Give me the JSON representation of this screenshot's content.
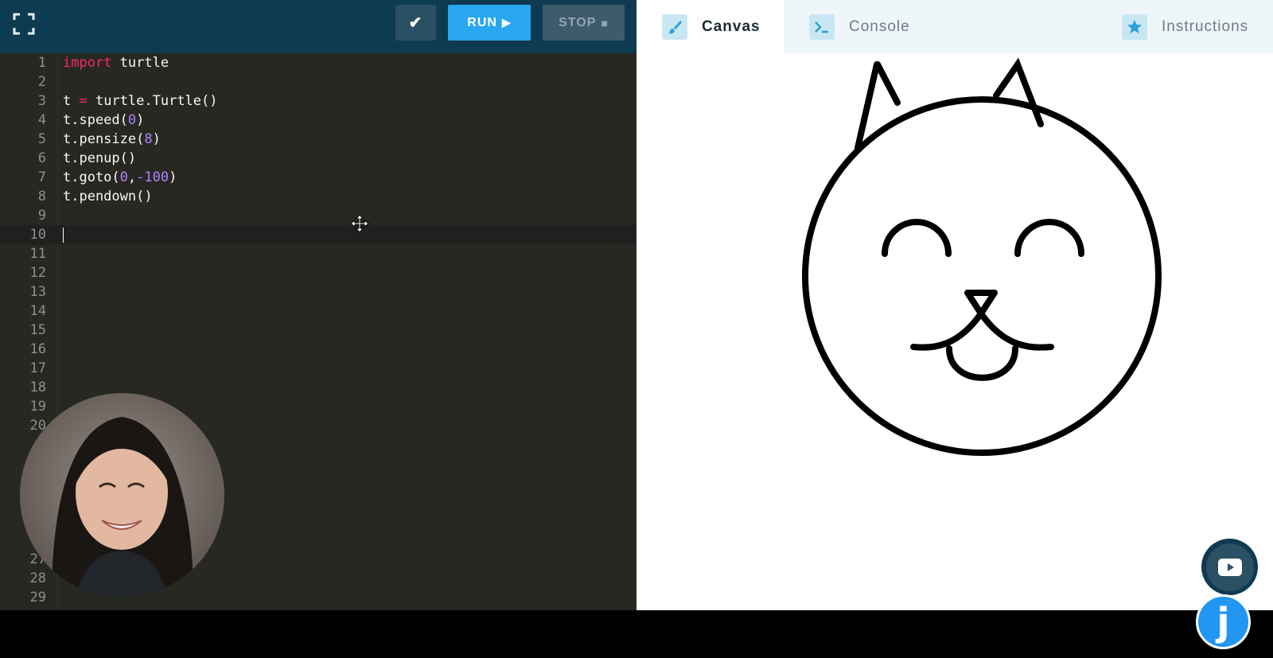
{
  "toolbar": {
    "fullscreen_icon": "fullscreen-icon",
    "check_icon": "checkmark-icon",
    "check_glyph": "✔",
    "run_label": "RUN",
    "run_glyph": "▶",
    "stop_label": "STOP",
    "stop_glyph": "■"
  },
  "editor": {
    "active_line": 10,
    "lines": [
      {
        "n": "1",
        "tokens": [
          {
            "t": "import",
            "c": "kw"
          },
          {
            "t": " turtle",
            "c": ""
          }
        ]
      },
      {
        "n": "2",
        "tokens": []
      },
      {
        "n": "3",
        "tokens": [
          {
            "t": "t ",
            "c": ""
          },
          {
            "t": "=",
            "c": "op"
          },
          {
            "t": " turtle.Turtle()",
            "c": ""
          }
        ]
      },
      {
        "n": "4",
        "tokens": [
          {
            "t": "t.speed(",
            "c": ""
          },
          {
            "t": "0",
            "c": "num"
          },
          {
            "t": ")",
            "c": ""
          }
        ]
      },
      {
        "n": "5",
        "tokens": [
          {
            "t": "t.pensize(",
            "c": ""
          },
          {
            "t": "8",
            "c": "num"
          },
          {
            "t": ")",
            "c": ""
          }
        ]
      },
      {
        "n": "6",
        "tokens": [
          {
            "t": "t.penup()",
            "c": ""
          }
        ]
      },
      {
        "n": "7",
        "tokens": [
          {
            "t": "t.goto(",
            "c": ""
          },
          {
            "t": "0",
            "c": "num"
          },
          {
            "t": ",",
            "c": ""
          },
          {
            "t": "-100",
            "c": "num"
          },
          {
            "t": ")",
            "c": ""
          }
        ]
      },
      {
        "n": "8",
        "tokens": [
          {
            "t": "t.pendown()",
            "c": ""
          }
        ]
      },
      {
        "n": "9",
        "tokens": []
      },
      {
        "n": "10",
        "tokens": []
      },
      {
        "n": "11",
        "tokens": []
      },
      {
        "n": "12",
        "tokens": []
      },
      {
        "n": "13",
        "tokens": []
      },
      {
        "n": "14",
        "tokens": []
      },
      {
        "n": "15",
        "tokens": []
      },
      {
        "n": "16",
        "tokens": []
      },
      {
        "n": "17",
        "tokens": []
      },
      {
        "n": "18",
        "tokens": []
      },
      {
        "n": "19",
        "tokens": []
      },
      {
        "n": "20",
        "tokens": []
      },
      {
        "n": "",
        "tokens": []
      },
      {
        "n": "",
        "tokens": []
      },
      {
        "n": "",
        "tokens": []
      },
      {
        "n": "",
        "tokens": []
      },
      {
        "n": "",
        "tokens": []
      },
      {
        "n": "2",
        "tokens": []
      },
      {
        "n": "27",
        "tokens": []
      },
      {
        "n": "28",
        "tokens": []
      },
      {
        "n": "29",
        "tokens": []
      }
    ]
  },
  "tabs": [
    {
      "key": "canvas",
      "label": "Canvas",
      "icon": "paintbrush-icon",
      "active": true
    },
    {
      "key": "console",
      "label": "Console",
      "icon": "terminal-icon",
      "active": false
    },
    {
      "key": "instructions",
      "label": "Instructions",
      "icon": "star-icon",
      "active": false
    }
  ],
  "floating": {
    "video_icon": "youtube-play-icon",
    "logo_letter": "j"
  },
  "colors": {
    "toolbar_bg": "#0e3a52",
    "editor_bg": "#272822",
    "run_button": "#29a7ef",
    "stop_button": "#3d5b6c",
    "keyword": "#f92672",
    "number": "#ae81ff",
    "tab_bar_bg": "#eef6f9",
    "tab_icon_bg": "#c9e6f3",
    "brand_blue": "#2196f3"
  }
}
